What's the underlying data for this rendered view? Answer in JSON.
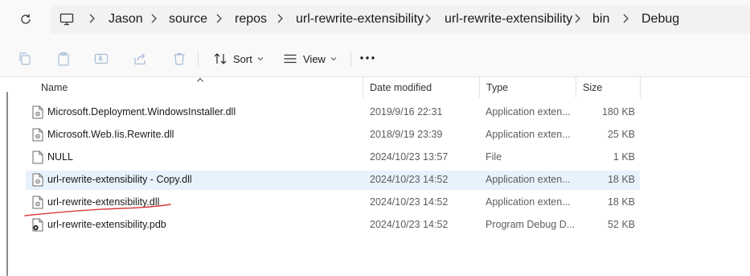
{
  "address_bar": {
    "crumbs": [
      "Jason",
      "source",
      "repos",
      "url-rewrite-extensibility",
      "url-rewrite-extensibility",
      "bin",
      "Debug"
    ]
  },
  "toolbar": {
    "sort_label": "Sort",
    "view_label": "View"
  },
  "columns": {
    "name": "Name",
    "date": "Date modified",
    "type": "Type",
    "size": "Size"
  },
  "files": [
    {
      "name": "Microsoft.Deployment.WindowsInstaller.dll",
      "date": "2019/9/16 22:31",
      "type": "Application exten...",
      "size": "180 KB",
      "icon": "dll-file-icon"
    },
    {
      "name": "Microsoft.Web.Iis.Rewrite.dll",
      "date": "2018/9/19 23:39",
      "type": "Application exten...",
      "size": "25 KB",
      "icon": "dll-file-icon"
    },
    {
      "name": "NULL",
      "date": "2024/10/23 13:57",
      "type": "File",
      "size": "1 KB",
      "icon": "blank-file-icon"
    },
    {
      "name": "url-rewrite-extensibility - Copy.dll",
      "date": "2024/10/23 14:52",
      "type": "Application exten...",
      "size": "18 KB",
      "icon": "dll-file-icon",
      "selected": true
    },
    {
      "name": "url-rewrite-extensibility.dll",
      "date": "2024/10/23 14:52",
      "type": "Application exten...",
      "size": "18 KB",
      "icon": "dll-file-icon"
    },
    {
      "name": "url-rewrite-extensibility.pdb",
      "date": "2024/10/23 14:52",
      "type": "Program Debug D...",
      "size": "52 KB",
      "icon": "pdb-file-icon"
    }
  ],
  "colors": {
    "selection": "#e8f2fc",
    "annotation": "#d83a3a"
  }
}
